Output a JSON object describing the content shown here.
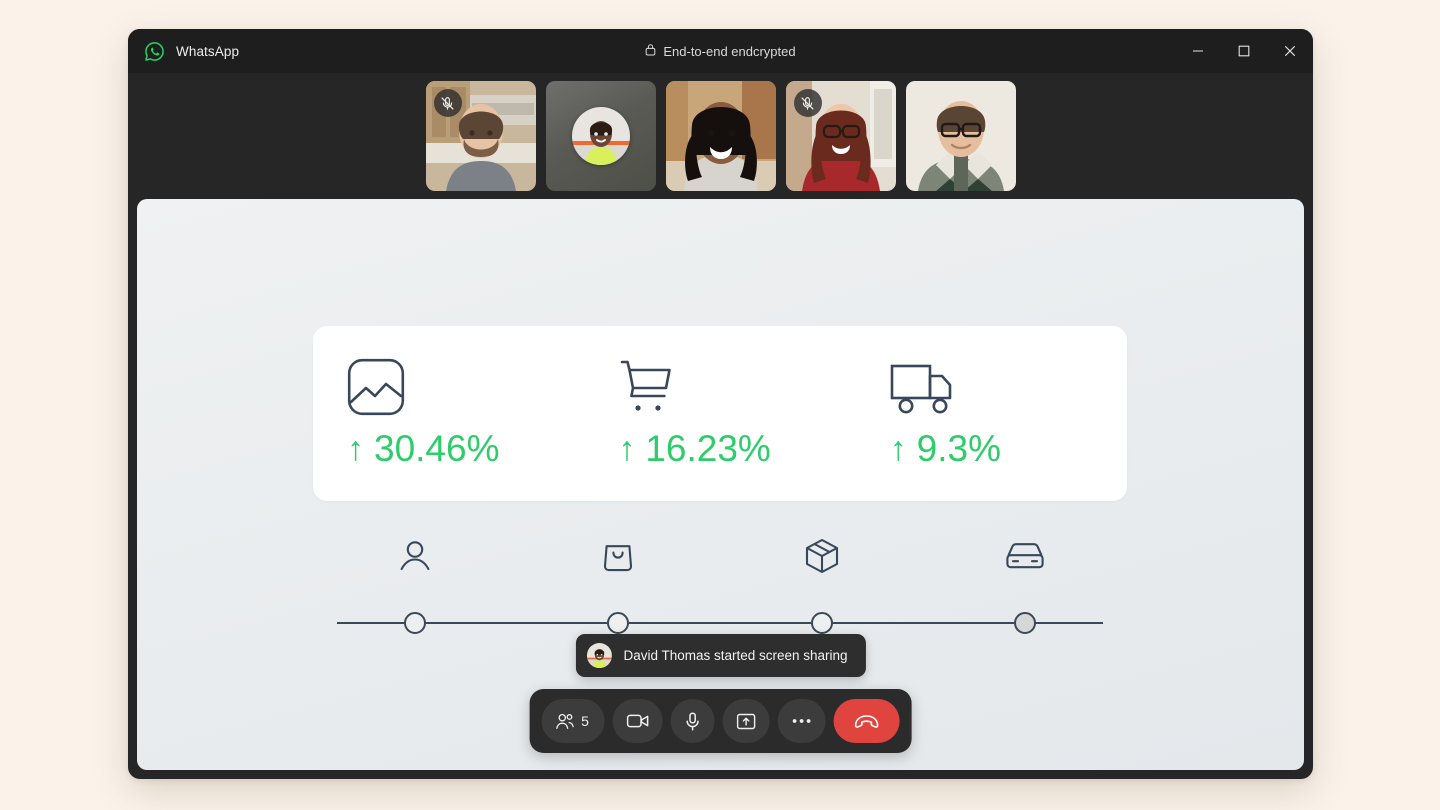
{
  "window": {
    "brand_name": "WhatsApp",
    "brand_icon": "whatsapp-logo-icon",
    "encryption_label": "End-to-end endcrypted",
    "encryption_icon": "lock-icon",
    "controls": {
      "minimize": "minimize-icon",
      "maximize": "maximize-icon",
      "close": "close-icon"
    }
  },
  "page": {
    "background_color": "#FBF3EA",
    "window_background": "#262626",
    "titlebar_background": "#1E1E1E"
  },
  "participants": [
    {
      "name": "participant-1",
      "camera_on": true,
      "muted": true,
      "mute_icon": "mic-off-icon"
    },
    {
      "name": "participant-2",
      "camera_on": false,
      "muted": false,
      "mute_icon": "mic-off-icon"
    },
    {
      "name": "participant-3",
      "camera_on": true,
      "muted": false,
      "mute_icon": "mic-off-icon"
    },
    {
      "name": "participant-4",
      "camera_on": true,
      "muted": true,
      "mute_icon": "mic-off-icon"
    },
    {
      "name": "participant-5",
      "camera_on": true,
      "muted": false,
      "mute_icon": "mic-off-icon"
    }
  ],
  "shared_screen": {
    "metrics": [
      {
        "icon": "image-chart-icon",
        "arrow": "↑",
        "value": "30.46%",
        "trend": "up"
      },
      {
        "icon": "shopping-cart-icon",
        "arrow": "↑",
        "value": "16.23%",
        "trend": "up"
      },
      {
        "icon": "delivery-truck-icon",
        "arrow": "↑",
        "value": "9.3%",
        "trend": "up"
      }
    ],
    "metric_color": "#2ECC6B",
    "tracker": {
      "steps": [
        {
          "icon": "user-icon",
          "state": "open"
        },
        {
          "icon": "shopping-bag-icon",
          "state": "open"
        },
        {
          "icon": "package-box-icon",
          "state": "open"
        },
        {
          "icon": "car-icon",
          "state": "filled"
        }
      ]
    }
  },
  "toast": {
    "avatar": "david-thomas-avatar",
    "message": "David Thomas started screen sharing"
  },
  "call_controls": {
    "participants": {
      "icon": "people-icon",
      "count": "5"
    },
    "camera": {
      "icon": "video-camera-icon"
    },
    "microphone": {
      "icon": "microphone-icon"
    },
    "share_screen": {
      "icon": "share-screen-icon"
    },
    "more": {
      "icon": "more-dots-icon"
    },
    "end_call": {
      "icon": "end-call-icon",
      "color": "#E0443E"
    }
  }
}
